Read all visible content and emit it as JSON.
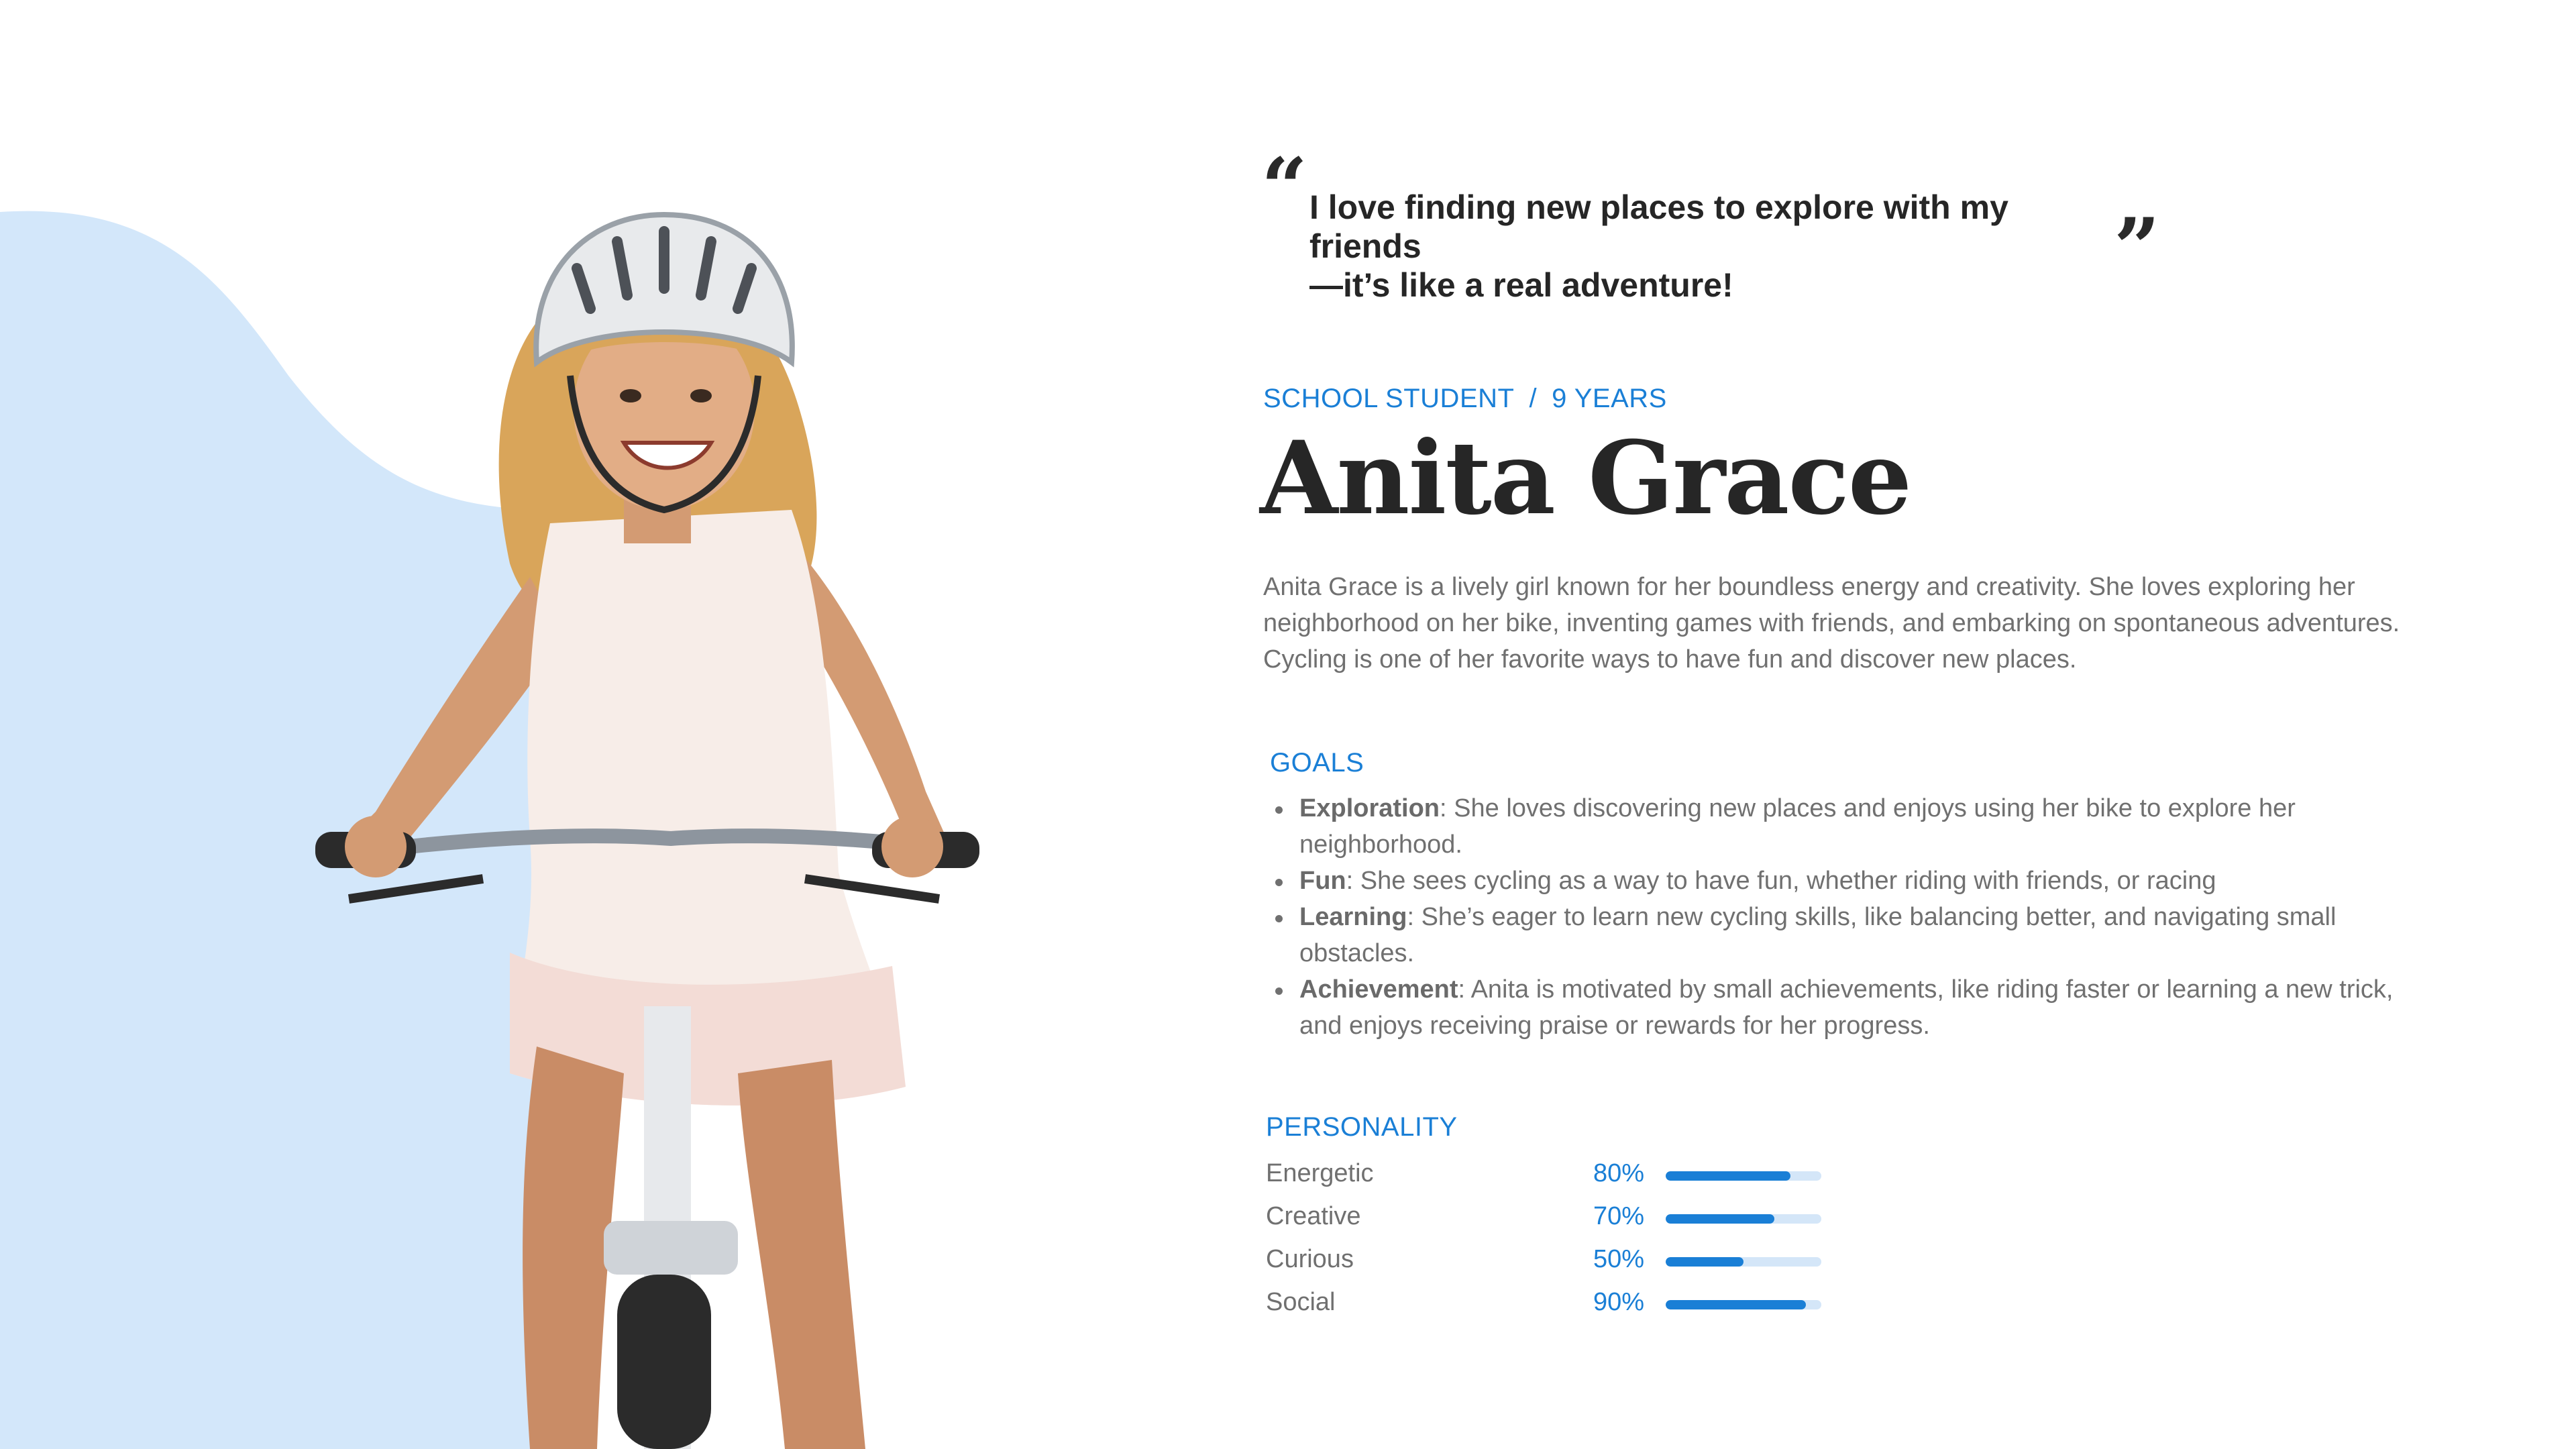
{
  "quote": {
    "line1": "I love finding new places to explore with my friends",
    "line2": "—it’s like a real adventure!",
    "open_mark": "“",
    "close_mark": "”"
  },
  "profile": {
    "role": "SCHOOL STUDENT",
    "separator": "/",
    "age": "9 YEARS",
    "name": "Anita Grace",
    "description": "Anita Grace is a lively girl known for her boundless energy and creativity. She loves exploring her neighborhood on her bike, inventing games with friends, and embarking on spontaneous adventures. Cycling is one of her favorite ways to have fun and discover new places."
  },
  "goals": {
    "title": "GOALS",
    "items": [
      {
        "label": "Exploration",
        "text": ": She loves discovering new places and enjoys using her bike to explore her neighborhood."
      },
      {
        "label": "Fun",
        "text": ": She sees cycling as a way to have fun, whether riding with friends, or racing"
      },
      {
        "label": "Learning",
        "text": ": She’s eager to learn new cycling skills, like balancing better, and navigating small obstacles."
      },
      {
        "label": "Achievement",
        "text": ": Anita is motivated by small achievements, like riding faster or learning a new trick, and enjoys receiving praise or rewards for her progress."
      }
    ]
  },
  "personality": {
    "title": "PERSONALITY",
    "traits": [
      {
        "label": "Energetic",
        "value_text": "80%",
        "value": 0.8
      },
      {
        "label": "Creative",
        "value_text": "70%",
        "value": 0.7
      },
      {
        "label": "Curious",
        "value_text": "50%",
        "value": 0.5
      },
      {
        "label": "Social",
        "value_text": "90%",
        "value": 0.9
      }
    ]
  },
  "colors": {
    "accent": "#1a7fd6",
    "blob": "#d3e7fa",
    "track": "#d4e6f8",
    "heading": "#262626",
    "body": "#707070"
  }
}
